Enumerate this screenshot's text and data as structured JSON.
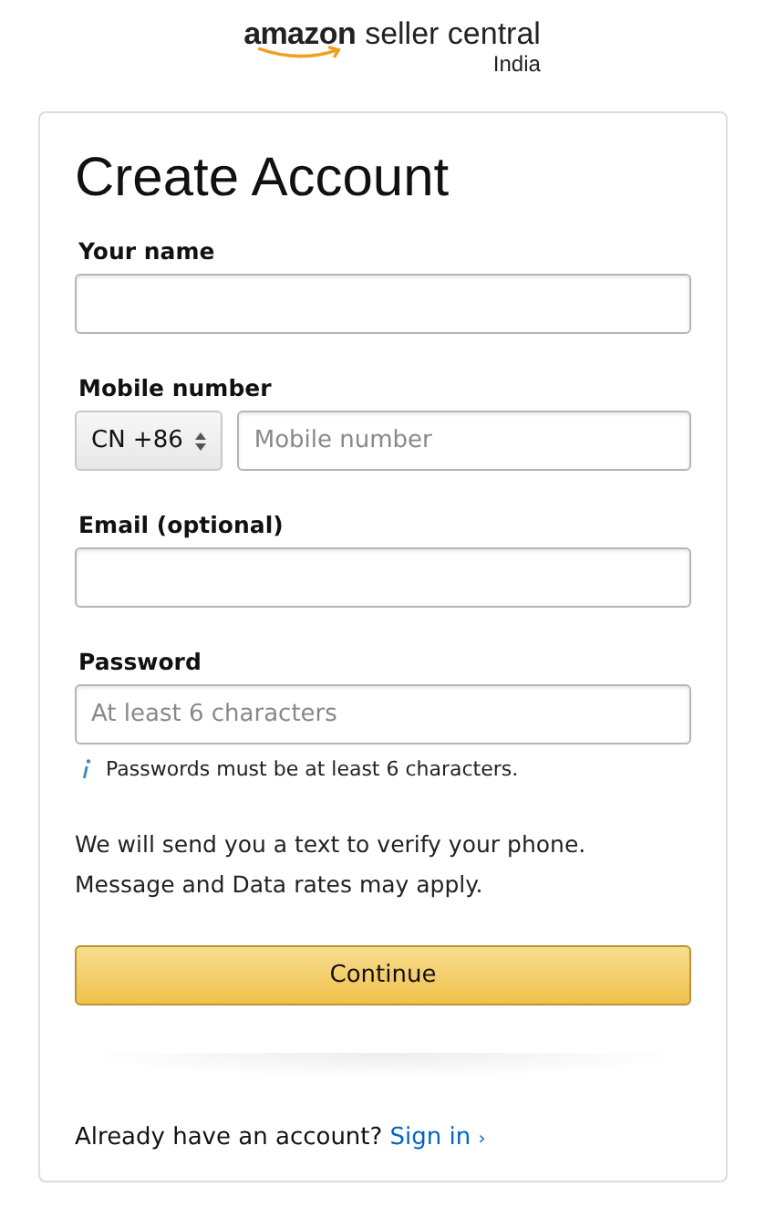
{
  "logo": {
    "brand": "amazon",
    "product": "seller central",
    "region": "India"
  },
  "title": "Create Account",
  "fields": [
    {
      "kind": "text",
      "label": "Your name"
    },
    {
      "kind": "phone",
      "label": "Mobile number",
      "country": "CN +86",
      "placeholder": "Mobile number"
    },
    {
      "kind": "text",
      "label": "Email (optional)"
    },
    {
      "kind": "text",
      "label": "Password",
      "placeholder": "At least 6 characters",
      "hint": "Passwords must be at least 6 characters."
    }
  ],
  "notice": [
    "We will send you a text to verify your phone.",
    "Message and Data rates may apply."
  ],
  "continue_button": "Continue",
  "signin": {
    "text": "Already have an account?",
    "link": "Sign in",
    "caret": "›"
  }
}
